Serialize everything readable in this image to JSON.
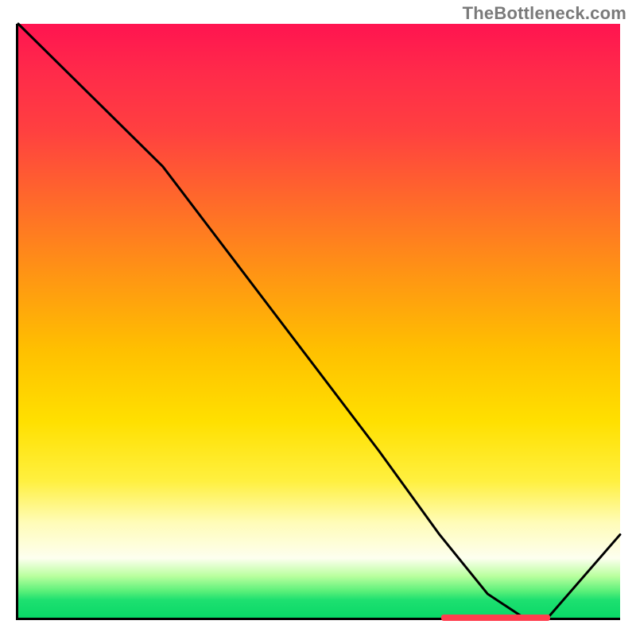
{
  "watermark": "TheBottleneck.com",
  "chart_data": {
    "type": "line",
    "title": "",
    "xlabel": "",
    "ylabel": "",
    "xlim": [
      0,
      100
    ],
    "ylim": [
      0,
      100
    ],
    "x": [
      0,
      12,
      24,
      36,
      48,
      60,
      70,
      78,
      84,
      88,
      100
    ],
    "values": [
      100,
      88,
      76,
      60,
      44,
      28,
      14,
      4,
      0,
      0,
      14
    ],
    "background_gradient": {
      "direction": "vertical",
      "stops": [
        {
          "pos": 0,
          "color": "#ff1450"
        },
        {
          "pos": 18,
          "color": "#ff4040"
        },
        {
          "pos": 42,
          "color": "#ff9414"
        },
        {
          "pos": 67,
          "color": "#ffe000"
        },
        {
          "pos": 90,
          "color": "#fdffef"
        },
        {
          "pos": 100,
          "color": "#09d867"
        }
      ]
    },
    "marker": {
      "x_start": 70,
      "x_end": 88,
      "y": 0,
      "color": "#ff3e4e"
    }
  }
}
